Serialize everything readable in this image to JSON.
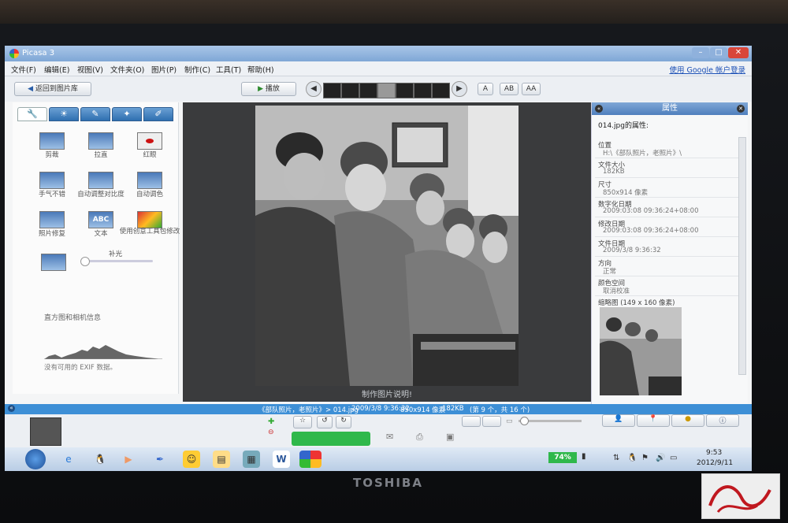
{
  "window": {
    "title": "Picasa 3",
    "signin": "使用 Google 帐户登录"
  },
  "menu": [
    "文件(F)",
    "编辑(E)",
    "视图(V)",
    "文件夹(O)",
    "图片(P)",
    "制作(C)",
    "工具(T)",
    "帮助(H)"
  ],
  "toolbar": {
    "back_label": "返回到图片库",
    "play_label": "播放",
    "view_modes": [
      "A",
      "AB",
      "AA"
    ]
  },
  "edit_tabs": [
    "wrench-icon",
    "sun-icon",
    "brush-icon",
    "effects-icon",
    "pen-icon"
  ],
  "tools": [
    {
      "label": "剪裁"
    },
    {
      "label": "拉直"
    },
    {
      "label": "红眼"
    },
    {
      "label": "手气不错"
    },
    {
      "label": "自动调整对比度"
    },
    {
      "label": "自动调色"
    },
    {
      "label": "照片修复"
    },
    {
      "label": "文本"
    },
    {
      "label": "使用创意工具包修改"
    }
  ],
  "fill_light_label": "补光",
  "histogram": {
    "title": "直方图和相机信息",
    "note": "没有可用的 EXIF 数据。"
  },
  "viewer": {
    "caption": "制作图片说明!"
  },
  "properties": {
    "header": "属性",
    "file_title": "014.jpg的属性:",
    "rows": [
      {
        "label": "位置",
        "value": "H:\\《部队照片，老照片》\\"
      },
      {
        "label": "文件大小",
        "value": "182KB"
      },
      {
        "label": "尺寸",
        "value": "850x914 像素"
      },
      {
        "label": "数字化日期",
        "value": "2009:03:08 09:36:24+08:00"
      },
      {
        "label": "修改日期",
        "value": "2009:03:08 09:36:24+08:00"
      },
      {
        "label": "文件日期",
        "value": "2009/3/8 9:36:32"
      },
      {
        "label": "方向",
        "value": "正常"
      },
      {
        "label": "颜色空间",
        "value": "取消校准"
      }
    ],
    "thumb_label": "缩略图 (149 x 160 像素)"
  },
  "status": {
    "path": "《部队照片，老照片》> 014.jpg",
    "date": "2009/3/8 9:36:32",
    "dims": "850x914 像素",
    "size": "182KB",
    "index": "(第 9 个，共 16 个)"
  },
  "taskbar": {
    "battery": "74%",
    "time": "9:53",
    "date": "2012/9/11"
  },
  "monitor_brand": "TOSHIBA",
  "colors": {
    "accent": "#3d8fd6",
    "title_bar": "#7fa7d6",
    "share_button": "#2fb84b"
  }
}
